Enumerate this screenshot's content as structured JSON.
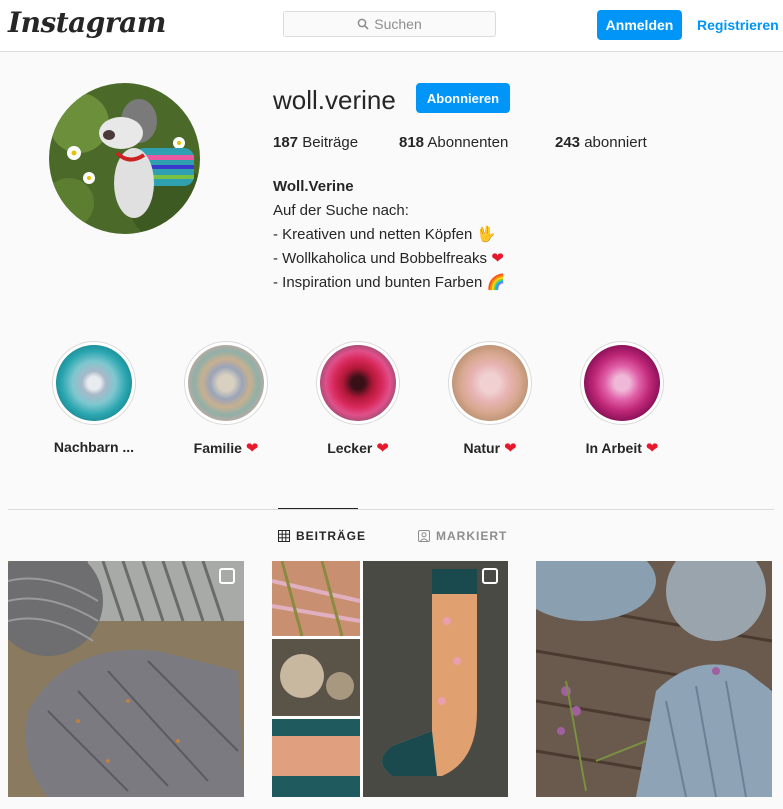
{
  "header": {
    "logo": "Instagram",
    "search_placeholder": "Suchen",
    "login_label": "Anmelden",
    "register_label": "Registrieren"
  },
  "profile": {
    "username": "woll.verine",
    "follow_label": "Abonnieren",
    "stats": [
      {
        "count": "187",
        "label": "Beiträge"
      },
      {
        "count": "818",
        "label": "Abonnenten"
      },
      {
        "count": "243",
        "label": "abonniert"
      }
    ],
    "display_name": "Woll.Verine",
    "bio_lines": [
      "Auf der Suche nach:",
      "- Kreativen und netten Köpfen 🖖",
      "- Wollkaholica und Bobbelfreaks",
      "- Inspiration und bunten Farben 🌈"
    ],
    "bio_line3_emoji": "❤"
  },
  "highlights": [
    {
      "label": "Nachbarn ...",
      "heart": ""
    },
    {
      "label": "Familie",
      "heart": "❤"
    },
    {
      "label": "Lecker",
      "heart": "❤"
    },
    {
      "label": "Natur",
      "heart": "❤"
    },
    {
      "label": "In Arbeit",
      "heart": "❤"
    }
  ],
  "tabs": {
    "posts": "BEITRÄGE",
    "tagged": "MARKIERT"
  },
  "colors": {
    "accent": "#0095f6",
    "heart": "#e8182c"
  }
}
